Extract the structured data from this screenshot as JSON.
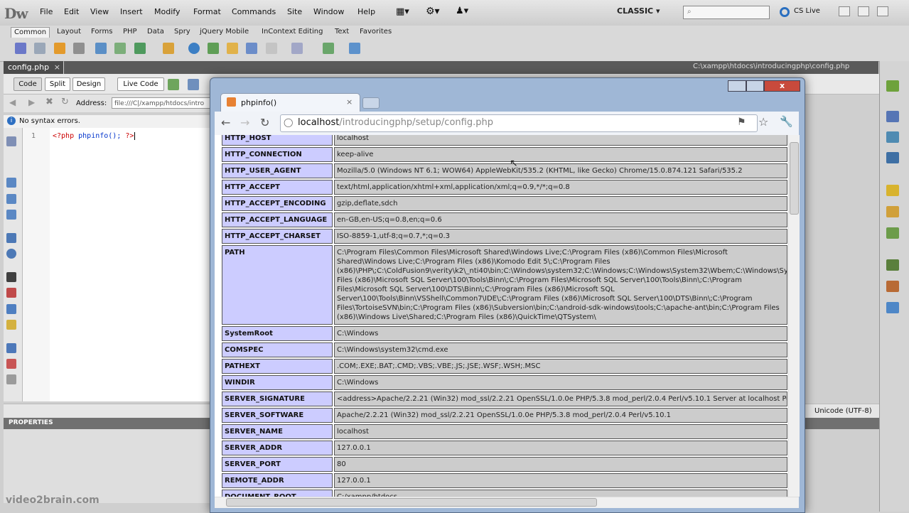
{
  "dreamweaver": {
    "logo": "Dw",
    "menus": [
      "File",
      "Edit",
      "View",
      "Insert",
      "Modify",
      "Format",
      "Commands",
      "Site",
      "Window",
      "Help"
    ],
    "workspace": "CLASSIC",
    "search_placeholder": "",
    "cs_live": "CS Live",
    "insert_tabs": [
      "Common",
      "Layout",
      "Forms",
      "PHP",
      "Data",
      "Spry",
      "jQuery Mobile",
      "InContext Editing",
      "Text",
      "Favorites"
    ],
    "doc_tab": "config.php",
    "doc_tab_close": "×",
    "file_path": "C:\\xampp\\htdocs\\introducingphp\\config.php",
    "view_buttons": [
      "Code",
      "Split",
      "Design",
      "Live Code"
    ],
    "address_label": "Address:",
    "address_value": "file:///C|/xampp/htdocs/intro",
    "syntax_status": "No syntax errors.",
    "line_number": "1",
    "code": {
      "open": "<?php",
      "call": "phpinfo();",
      "close": "?>"
    },
    "encoding": "Unicode (UTF-8)",
    "properties_label": "PROPERTIES",
    "watermark": "video2brain.com"
  },
  "browser": {
    "tab_title": "phpinfo()",
    "tab_close": "×",
    "close_glyph": "x",
    "url_host": "localhost",
    "url_path": "/introducingphp/setup/config.php",
    "rows": [
      {
        "key": "HTTP_HOST",
        "value": "localhost"
      },
      {
        "key": "HTTP_CONNECTION",
        "value": "keep-alive"
      },
      {
        "key": "HTTP_USER_AGENT",
        "value": "Mozilla/5.0 (Windows NT 6.1; WOW64) AppleWebKit/535.2 (KHTML, like Gecko) Chrome/15.0.874.121 Safari/535.2"
      },
      {
        "key": "HTTP_ACCEPT",
        "value": "text/html,application/xhtml+xml,application/xml;q=0.9,*/*;q=0.8"
      },
      {
        "key": "HTTP_ACCEPT_ENCODING",
        "value": "gzip,deflate,sdch"
      },
      {
        "key": "HTTP_ACCEPT_LANGUAGE",
        "value": "en-GB,en-US;q=0.8,en;q=0.6"
      },
      {
        "key": "HTTP_ACCEPT_CHARSET",
        "value": "ISO-8859-1,utf-8;q=0.7,*;q=0.3"
      },
      {
        "key": "PATH",
        "value": "C:\\Program Files\\Common Files\\Microsoft Shared\\Windows Live;C:\\Program Files (x86)\\Common Files\\Microsoft Shared\\Windows Live;C:\\Program Files (x86)\\Komodo Edit 5\\;C:\\Program Files (x86)\\PHP\\;C:\\ColdFusion9\\verity\\k2\\_nti40\\bin;C:\\Windows\\system32;C:\\Windows;C:\\Windows\\System32\\Wbem;C:\\Windows\\System32\\WindowsPowerShell\\v1.0\\;C:\\Program Files (x86)\\Microsoft SQL Server\\100\\Tools\\Binn\\;C:\\Program Files\\Microsoft SQL Server\\100\\Tools\\Binn\\;C:\\Program Files\\Microsoft SQL Server\\100\\DTS\\Binn\\;C:\\Program Files (x86)\\Microsoft SQL Server\\100\\Tools\\Binn\\VSShell\\Common7\\IDE\\;C:\\Program Files (x86)\\Microsoft SQL Server\\100\\DTS\\Binn\\;C:\\Program Files\\TortoiseSVN\\bin;C:\\Program Files (x86)\\Subversion\\bin;C:\\android-sdk-windows\\tools;C:\\apache-ant\\bin;C:\\Program Files (x86)\\Windows Live\\Shared;C:\\Program Files (x86)\\QuickTime\\QTSystem\\"
      },
      {
        "key": "SystemRoot",
        "value": "C:\\Windows"
      },
      {
        "key": "COMSPEC",
        "value": "C:\\Windows\\system32\\cmd.exe"
      },
      {
        "key": "PATHEXT",
        "value": ".COM;.EXE;.BAT;.CMD;.VBS;.VBE;.JS;.JSE;.WSF;.WSH;.MSC"
      },
      {
        "key": "WINDIR",
        "value": "C:\\Windows"
      },
      {
        "key": "SERVER_SIGNATURE",
        "value": "<address>Apache/2.2.21 (Win32) mod_ssl/2.2.21 OpenSSL/1.0.0e PHP/5.3.8 mod_perl/2.0.4 Perl/v5.10.1 Server at localhost Port 80</address>"
      },
      {
        "key": "SERVER_SOFTWARE",
        "value": "Apache/2.2.21 (Win32) mod_ssl/2.2.21 OpenSSL/1.0.0e PHP/5.3.8 mod_perl/2.0.4 Perl/v5.10.1"
      },
      {
        "key": "SERVER_NAME",
        "value": "localhost"
      },
      {
        "key": "SERVER_ADDR",
        "value": "127.0.0.1"
      },
      {
        "key": "SERVER_PORT",
        "value": "80"
      },
      {
        "key": "REMOTE_ADDR",
        "value": "127.0.0.1"
      },
      {
        "key": "DOCUMENT_ROOT",
        "value": "C:/xampp/htdocs"
      }
    ]
  },
  "colors": {
    "key_cell": "#ccccff",
    "value_cell": "#cccccc",
    "close_button": "#c84a3c"
  }
}
